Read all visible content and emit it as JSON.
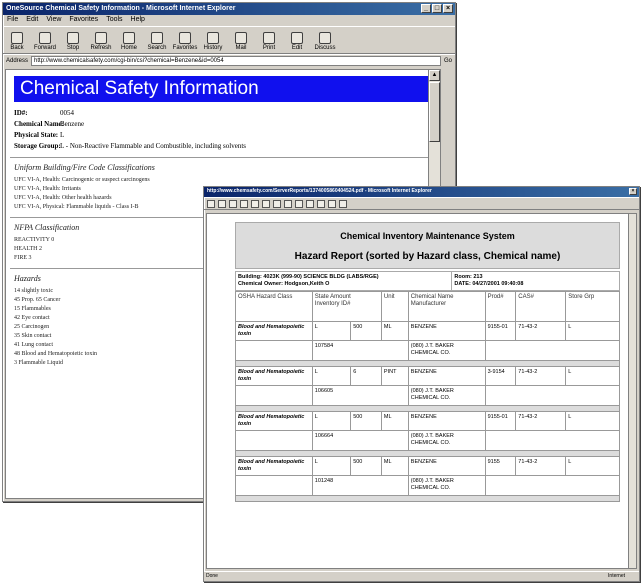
{
  "back_window": {
    "title": "OneSource Chemical Safety Information - Microsoft Internet Explorer",
    "menu": [
      "File",
      "Edit",
      "View",
      "Favorites",
      "Tools",
      "Help"
    ],
    "toolbar": [
      "Back",
      "Forward",
      "Stop",
      "Refresh",
      "Home",
      "Search",
      "Favorites",
      "History",
      "Mail",
      "Print",
      "Edit",
      "Discuss"
    ],
    "address_label": "Address",
    "address_value": "http://www.chemicalsafety.com/cgi-bin/csi?chemical=Benzene&id=0054",
    "go_label": "Go",
    "banner": "Chemical Safety Information",
    "fields": [
      {
        "label": "ID#:",
        "value": "0054"
      },
      {
        "label": "Chemical Name:",
        "value": "Benzene"
      },
      {
        "label": "Physical State:",
        "value": "L"
      },
      {
        "label": "Storage Group:",
        "value": "L - Non-Reactive Flammable and Combustible, including solvents"
      }
    ],
    "sections": [
      {
        "heading": "Uniform Building/Fire Code Classifications",
        "items": [
          "UFC VI-A, Health: Carcinogenic or suspect carcinogens",
          "UFC VI-A, Health: Irritants",
          "UFC VI-A, Health: Other health hazards",
          "UFC VI-A, Physical: Flammable liquids - Class I-B"
        ]
      },
      {
        "heading": "NFPA Classification",
        "items": [
          "REACTIVITY 0",
          "HEALTH 2",
          "FIRE 3"
        ]
      },
      {
        "heading": "Hazards",
        "items": [
          "14 slightly toxic",
          "45 Prop. 65 Cancer",
          "15 Flammables",
          "42 Eye contact",
          "25 Carcinogen",
          "35 Skin contact",
          "41 Lung contact",
          "48 Blood and Hematopoietic toxin",
          "3 Flammable Liquid"
        ]
      }
    ]
  },
  "front_window": {
    "title": "http://www.chemsafety.com/ServerReports/1374005860404524.pdf - Microsoft Internet Explorer",
    "report": {
      "title1": "Chemical Inventory Maintenance System",
      "title2": "Hazard Report (sorted by Hazard class, Chemical name)",
      "building": "Building: 4023K (999-90) SCIENCE BLDG (LABS/RGE)",
      "owner": "Chemical Owner: Hodgson,Keith O",
      "room": "Room: 213",
      "date": "DATE: 04/27/2001 09:40:08",
      "headers": [
        "OSHA Hazard Class",
        "State  Amount\nInventory ID#",
        "",
        "Unit",
        "Chemical Name\nManufacturer",
        "Prod#",
        "CAS#",
        "Store Grp"
      ],
      "records": [
        {
          "hazard": "Blood and Hematopoietic toxin",
          "state": "L",
          "amount": "500",
          "unit": "ML",
          "name": "BENZENE",
          "prod": "9155-01",
          "cas": "71-43-2",
          "grp": "L",
          "inv_id": "107584",
          "mfr": "(080) J.T. BAKER CHEMICAL CO."
        },
        {
          "hazard": "Blood and Hematopoietic toxin",
          "state": "L",
          "amount": "6",
          "unit": "PINT",
          "name": "BENZENE",
          "prod": "3-9154",
          "cas": "71-43-2",
          "grp": "L",
          "inv_id": "106605",
          "mfr": "(080) J.T. BAKER CHEMICAL CO."
        },
        {
          "hazard": "Blood and Hematopoietic toxin",
          "state": "L",
          "amount": "500",
          "unit": "ML",
          "name": "BENZENE",
          "prod": "9155-01",
          "cas": "71-43-2",
          "grp": "L",
          "inv_id": "106664",
          "mfr": "(080) J.T. BAKER CHEMICAL CO."
        },
        {
          "hazard": "Blood and Hematopoietic toxin",
          "state": "L",
          "amount": "500",
          "unit": "ML",
          "name": "BENZENE",
          "prod": "9155",
          "cas": "71-43-2",
          "grp": "L",
          "inv_id": "101248",
          "mfr": "(080) J.T. BAKER CHEMICAL CO."
        }
      ]
    },
    "status_left": "Done",
    "status_right": "Internet"
  },
  "colors": {
    "banner": "#1010ee",
    "titlebar": "#0a246a",
    "chrome": "#d4d0c8"
  }
}
